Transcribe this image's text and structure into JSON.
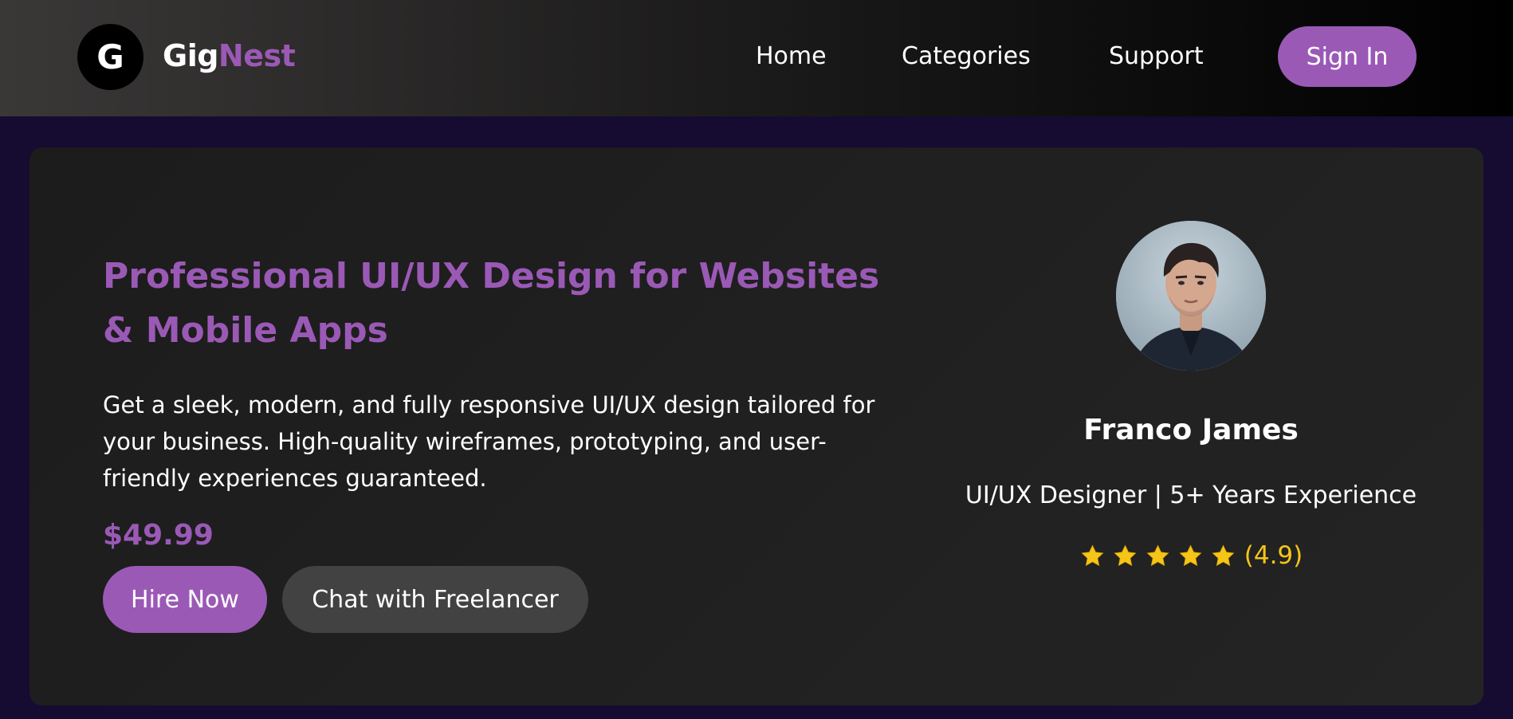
{
  "header": {
    "logo_letter": "G",
    "brand_part1": "Gig",
    "brand_part2": "Nest",
    "nav": {
      "home": "Home",
      "categories": "Categories",
      "support": "Support"
    },
    "signin_label": "Sign In"
  },
  "gig": {
    "title": "Professional UI/UX Design for Websites & Mobile Apps",
    "description": "Get a sleek, modern, and fully responsive UI/UX design tailored for your business. High-quality wireframes, prototyping, and user-friendly experiences guaranteed.",
    "price": "$49.99",
    "hire_label": "Hire Now",
    "chat_label": "Chat with Freelancer"
  },
  "freelancer": {
    "name": "Franco James",
    "role": "UI/UX Designer | 5+ Years Experience",
    "rating_text": "(4.9)",
    "rating_value": 4.9,
    "stars_filled": 5,
    "stars_total": 5
  },
  "colors": {
    "accent": "#9b59b6",
    "page_bg": "#160b30",
    "card_bg": "#222222",
    "star": "#f5c518",
    "secondary_button": "#424242"
  },
  "icons": [
    "star-icon",
    "avatar-photo"
  ]
}
